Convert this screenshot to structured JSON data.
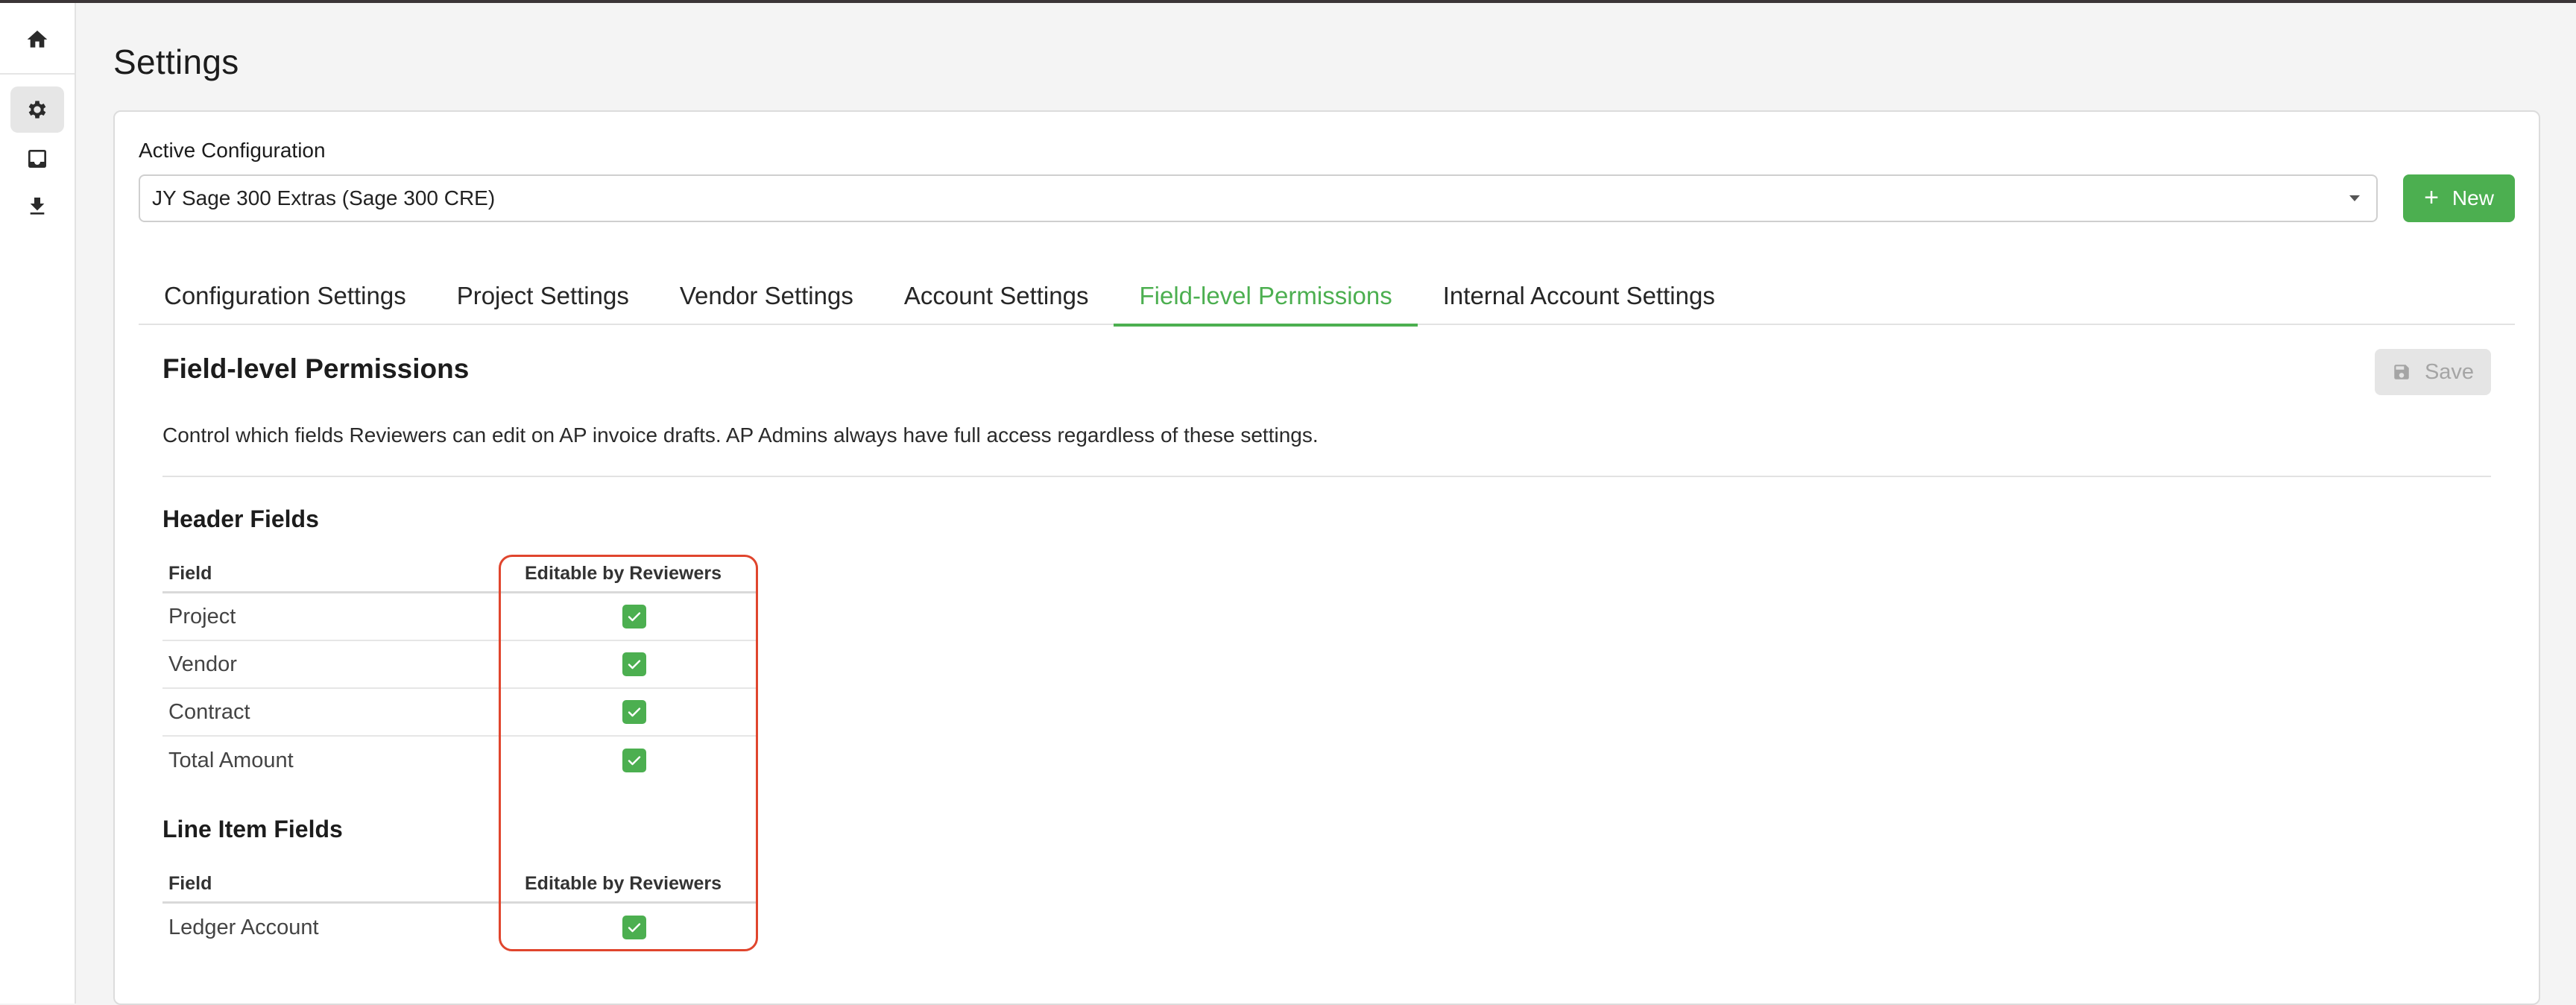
{
  "page": {
    "title": "Settings"
  },
  "sidebar": {
    "items": [
      {
        "name": "home",
        "icon": "home-icon"
      },
      {
        "name": "settings",
        "icon": "gear-icon",
        "active": true
      },
      {
        "name": "inbox",
        "icon": "inbox-icon"
      },
      {
        "name": "download",
        "icon": "download-icon"
      }
    ]
  },
  "configuration": {
    "label": "Active Configuration",
    "selected": "JY Sage 300 Extras (Sage 300 CRE)",
    "new_label": "New"
  },
  "tabs": [
    {
      "label": "Configuration Settings"
    },
    {
      "label": "Project Settings"
    },
    {
      "label": "Vendor Settings"
    },
    {
      "label": "Account Settings"
    },
    {
      "label": "Field-level Permissions",
      "selected": true
    },
    {
      "label": "Internal Account Settings"
    }
  ],
  "section": {
    "title": "Field-level Permissions",
    "save_label": "Save",
    "description": "Control which fields Reviewers can edit on AP invoice drafts. AP Admins always have full access regardless of these settings."
  },
  "header_fields": {
    "title": "Header Fields",
    "col_field": "Field",
    "col_editable": "Editable by Reviewers",
    "rows": [
      {
        "field": "Project",
        "editable": true
      },
      {
        "field": "Vendor",
        "editable": true
      },
      {
        "field": "Contract",
        "editable": true
      },
      {
        "field": "Total Amount",
        "editable": true
      }
    ]
  },
  "line_item_fields": {
    "title": "Line Item Fields",
    "col_field": "Field",
    "col_editable": "Editable by Reviewers",
    "rows": [
      {
        "field": "Ledger Account",
        "editable": true
      }
    ]
  },
  "colors": {
    "accent": "#4caf50",
    "highlight": "#e0452d"
  }
}
